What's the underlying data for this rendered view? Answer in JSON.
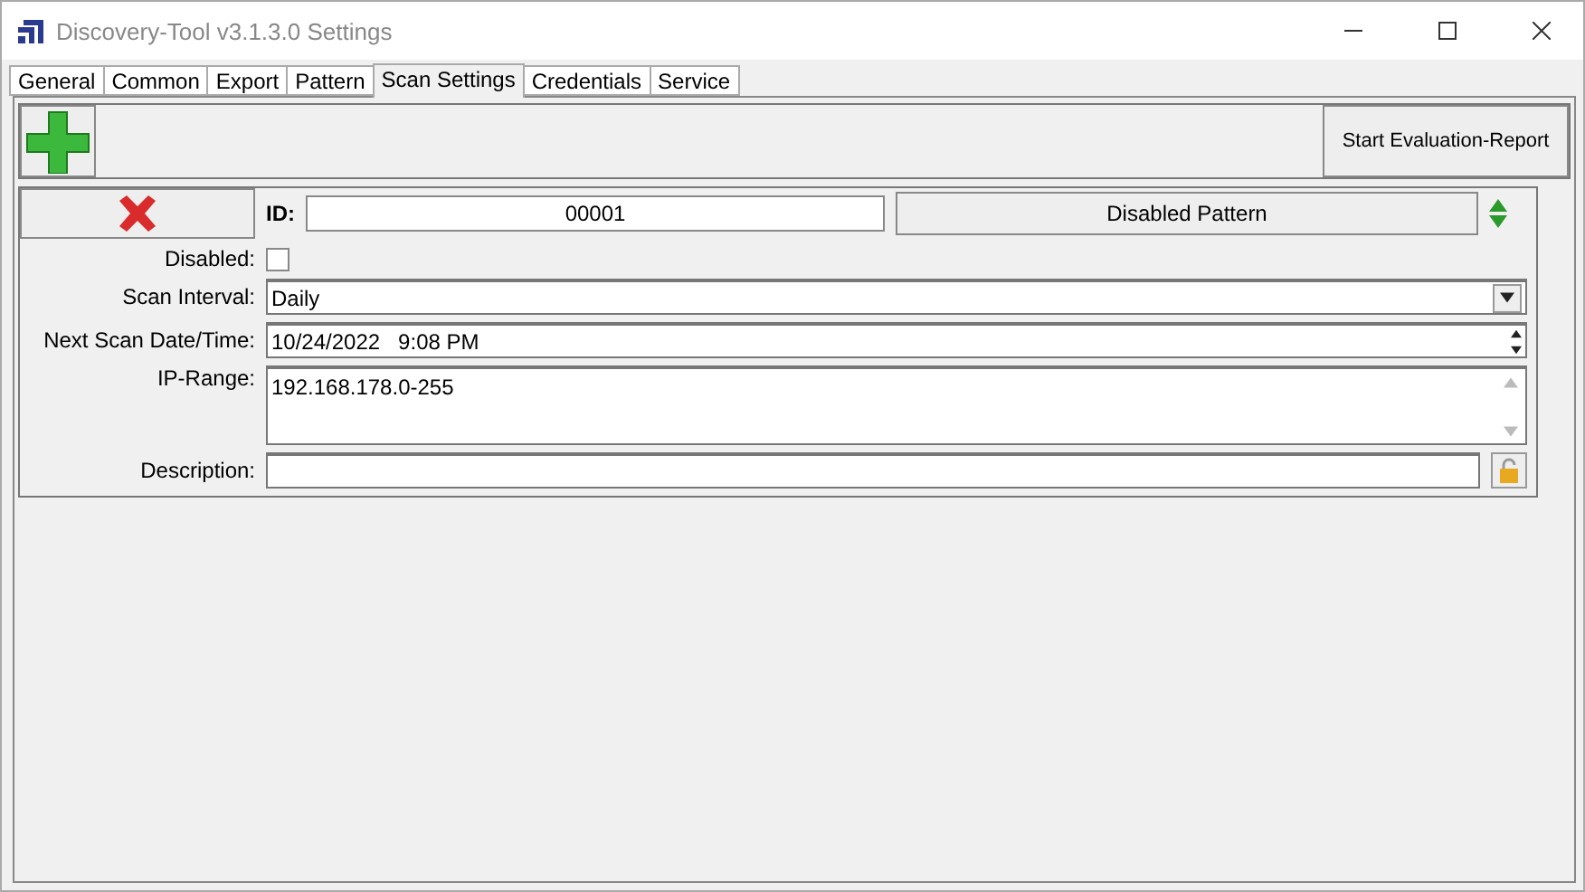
{
  "window": {
    "title": "Discovery-Tool v3.1.3.0 Settings"
  },
  "tabs": [
    {
      "label": "General",
      "selected": false
    },
    {
      "label": "Common",
      "selected": false
    },
    {
      "label": "Export",
      "selected": false
    },
    {
      "label": "Pattern",
      "selected": false
    },
    {
      "label": "Scan Settings",
      "selected": true
    },
    {
      "label": "Credentials",
      "selected": false
    },
    {
      "label": "Service",
      "selected": false
    }
  ],
  "toolbar": {
    "report_button": "Start Evaluation-Report"
  },
  "pattern": {
    "id_label": "ID:",
    "id": "00001",
    "status_button": "Disabled Pattern",
    "disabled": {
      "label": "Disabled:",
      "checked": false
    },
    "scan_interval": {
      "label": "Scan Interval:",
      "value": "Daily"
    },
    "next_scan": {
      "label": "Next Scan Date/Time:",
      "value": "10/24/2022   9:08 PM"
    },
    "ip_range": {
      "label": "IP-Range:",
      "value": "192.168.178.0-255"
    },
    "description": {
      "label": "Description:"
    }
  }
}
